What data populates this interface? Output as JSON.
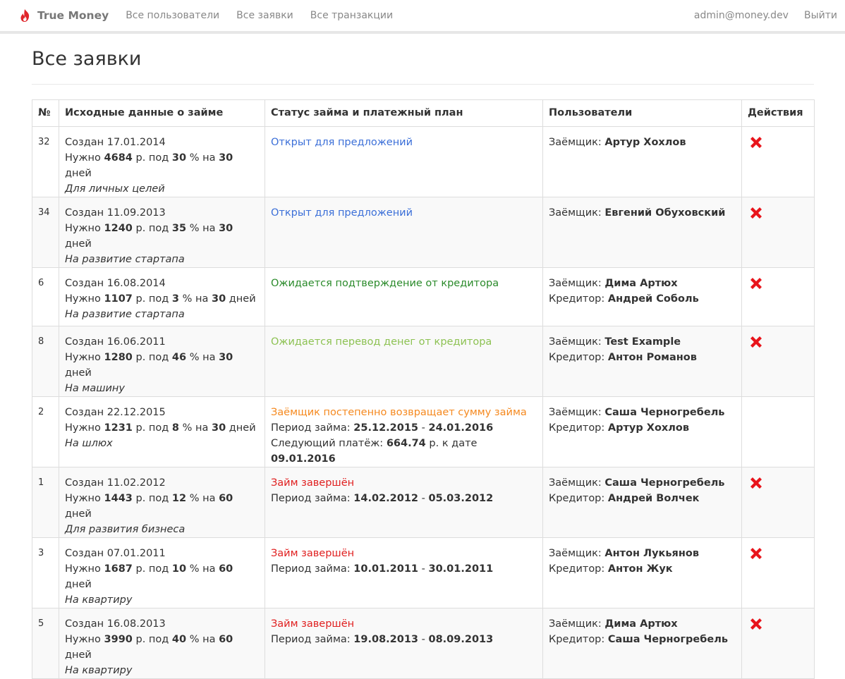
{
  "navbar": {
    "brand": "True Money",
    "links": [
      "Все пользователи",
      "Все заявки",
      "Все транзакции"
    ],
    "user_email": "admin@money.dev",
    "logout_label": "Выйти",
    "brand_icon": "flame-icon"
  },
  "page_title": "Все заявки",
  "table": {
    "headers": [
      "№",
      "Исходные данные о займе",
      "Статус займа и платежный план",
      "Пользователи",
      "Действия"
    ],
    "rows": [
      {
        "num": "32",
        "created_label": "Создан",
        "created": "17.01.2014",
        "need_label": "Нужно",
        "amount": "4684",
        "currency_pod": "р. под",
        "percent": "30",
        "pct_na": "% на",
        "days": "30",
        "days_label": "дней",
        "purpose": "Для личных целей",
        "status": "Открыт для предложений",
        "status_kind": "open",
        "borrower_label": "Заёмщик:",
        "borrower": "Артур Хохлов",
        "lender_label": "",
        "lender": "",
        "delete": true
      },
      {
        "num": "34",
        "created_label": "Создан",
        "created": "11.09.2013",
        "need_label": "Нужно",
        "amount": "1240",
        "currency_pod": "р. под",
        "percent": "35",
        "pct_na": "% на",
        "days": "30",
        "days_label": "дней",
        "purpose": "На развитие стартапа",
        "status": "Открыт для предложений",
        "status_kind": "open",
        "borrower_label": "Заёмщик:",
        "borrower": "Евгений Обуховский",
        "lender_label": "",
        "lender": "",
        "delete": true
      },
      {
        "num": "6",
        "created_label": "Создан",
        "created": "16.08.2014",
        "need_label": "Нужно",
        "amount": "1107",
        "currency_pod": "р. под",
        "percent": "3",
        "pct_na": "% на",
        "days": "30",
        "days_label": "дней",
        "purpose": "На развитие стартапа",
        "status": "Ожидается подтверждение от кредитора",
        "status_kind": "confirm",
        "borrower_label": "Заёмщик:",
        "borrower": "Дима Артюх",
        "lender_label": "Кредитор:",
        "lender": "Андрей Соболь",
        "delete": true
      },
      {
        "num": "8",
        "created_label": "Создан",
        "created": "16.06.2011",
        "need_label": "Нужно",
        "amount": "1280",
        "currency_pod": "р. под",
        "percent": "46",
        "pct_na": "% на",
        "days": "30",
        "days_label": "дней",
        "purpose": "На машину",
        "status": "Ожидается перевод денег от кредитора",
        "status_kind": "transfer",
        "borrower_label": "Заёмщик:",
        "borrower": "Test Example",
        "lender_label": "Кредитор:",
        "lender": "Антон Романов",
        "delete": true
      },
      {
        "num": "2",
        "created_label": "Создан",
        "created": "22.12.2015",
        "need_label": "Нужно",
        "amount": "1231",
        "currency_pod": "р. под",
        "percent": "8",
        "pct_na": "% на",
        "days": "30",
        "days_label": "дней",
        "purpose": "На шлюх",
        "status": "Заёмщик постепенно возвращает сумму займа",
        "status_kind": "repay",
        "period_label": "Период займа:",
        "period_start": "25.12.2015",
        "period_end": "24.01.2016",
        "next_label": "Следующий платёж:",
        "next_amount": "664.74",
        "next_mid": "р. к дате",
        "next_date": "09.01.2016",
        "borrower_label": "Заёмщик:",
        "borrower": "Саша Черногребель",
        "lender_label": "Кредитор:",
        "lender": "Артур Хохлов",
        "delete": false
      },
      {
        "num": "1",
        "created_label": "Создан",
        "created": "11.02.2012",
        "need_label": "Нужно",
        "amount": "1443",
        "currency_pod": "р. под",
        "percent": "12",
        "pct_na": "% на",
        "days": "60",
        "days_label": "дней",
        "purpose": "Для развития бизнеса",
        "status": "Займ завершён",
        "status_kind": "done",
        "period_label": "Период займа:",
        "period_start": "14.02.2012",
        "period_end": "05.03.2012",
        "borrower_label": "Заёмщик:",
        "borrower": "Саша Черногребель",
        "lender_label": "Кредитор:",
        "lender": "Андрей Волчек",
        "delete": true
      },
      {
        "num": "3",
        "created_label": "Создан",
        "created": "07.01.2011",
        "need_label": "Нужно",
        "amount": "1687",
        "currency_pod": "р. под",
        "percent": "10",
        "pct_na": "% на",
        "days": "60",
        "days_label": "дней",
        "purpose": "На квартиру",
        "status": "Займ завершён",
        "status_kind": "done",
        "period_label": "Период займа:",
        "period_start": "10.01.2011",
        "period_end": "30.01.2011",
        "borrower_label": "Заёмщик:",
        "borrower": "Антон Лукьянов",
        "lender_label": "Кредитор:",
        "lender": "Антон Жук",
        "delete": true
      },
      {
        "num": "5",
        "created_label": "Создан",
        "created": "16.08.2013",
        "need_label": "Нужно",
        "amount": "3990",
        "currency_pod": "р. под",
        "percent": "40",
        "pct_na": "% на",
        "days": "60",
        "days_label": "дней",
        "purpose": "На квартиру",
        "status": "Займ завершён",
        "status_kind": "done",
        "period_label": "Период займа:",
        "period_start": "19.08.2013",
        "period_end": "08.09.2013",
        "borrower_label": "Заёмщик:",
        "borrower": "Дима Артюх",
        "lender_label": "Кредитор:",
        "lender": "Саша Черногребель",
        "delete": true
      }
    ]
  },
  "icons": {
    "delete": "delete-x-icon"
  },
  "colors": {
    "status_open": "#3b6fd8",
    "status_confirm": "#2a8a2a",
    "status_transfer": "#8dc253",
    "status_repay": "#f5891f",
    "status_done": "#e02020",
    "delete_icon": "#e8141b",
    "brand_icon": "#e0262b"
  }
}
